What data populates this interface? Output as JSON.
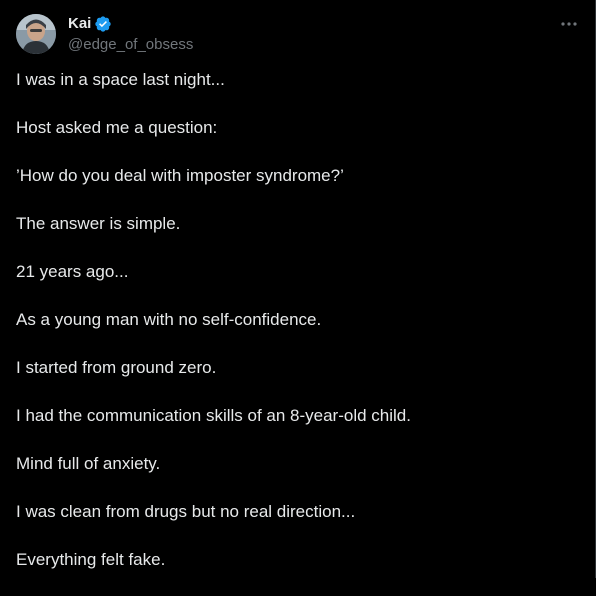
{
  "author": {
    "display_name": "Kai",
    "handle": "@edge_of_obsess",
    "verified": true
  },
  "icons": {
    "verified": "verified-badge-icon",
    "more": "more-horizontal-icon"
  },
  "colors": {
    "background": "#000000",
    "text": "#e7e9ea",
    "secondary_text": "#71767b",
    "verified": "#1d9bf0"
  },
  "tweet": {
    "lines": [
      "I was in a space last night...",
      "Host asked me a question:",
      "’How do you deal with imposter syndrome?’",
      "The answer is simple.",
      "21 years ago...",
      "As a young man with no self-confidence.",
      "I started from ground zero.",
      "I had the communication skills of an 8-year-old child.",
      "Mind full of anxiety.",
      "I was clean from drugs but no real direction...",
      "Everything felt fake."
    ]
  }
}
